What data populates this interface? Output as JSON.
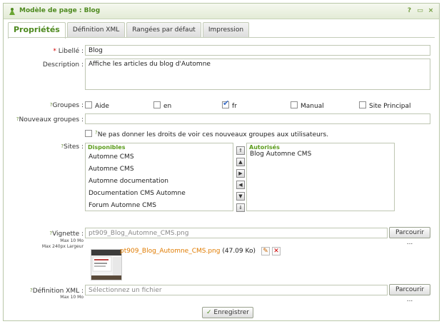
{
  "window": {
    "title": "Modèle de page : Blog",
    "help": "?"
  },
  "tabs": [
    {
      "label": "Propriétés",
      "active": true
    },
    {
      "label": "Définition XML",
      "active": false
    },
    {
      "label": "Rangées par défaut",
      "active": false
    },
    {
      "label": "Impression",
      "active": false
    }
  ],
  "form": {
    "libelle": {
      "label": "Libellé :",
      "required_mark": "*",
      "value": "Blog"
    },
    "description": {
      "label": "Description :",
      "value": "Affiche les articles du blog d'Automne"
    },
    "groupes": {
      "label": "Groupes :",
      "items": [
        {
          "label": "Aide",
          "checked": false
        },
        {
          "label": "en",
          "checked": false
        },
        {
          "label": "fr",
          "checked": true
        },
        {
          "label": "Manual",
          "checked": false
        },
        {
          "label": "Site Principal",
          "checked": false
        }
      ]
    },
    "nouveaux_groupes": {
      "label": "Nouveaux groupes :",
      "value": ""
    },
    "no_rights_label": "Ne pas donner les droits de voir ces nouveaux groupes aux utilisateurs.",
    "sites": {
      "label": "Sites :",
      "available_header": "Disponibles",
      "available": [
        "Automne CMS",
        "Automne CMS",
        "Automne documentation",
        "Documentation CMS Automne",
        "Forum Automne CMS"
      ],
      "authorized_header": "Autorisés",
      "authorized": [
        "Blog Automne CMS"
      ]
    },
    "vignette": {
      "label": "Vignette :",
      "value": "pt909_Blog_Automne_CMS.png",
      "hint1": "Max 10 Mo",
      "hint2": "Max 240px Largeur",
      "file_name": "pt909_Blog_Automne_CMS.png",
      "file_size": "(47.09 Ko)",
      "browse": "Parcourir ..."
    },
    "definition_xml": {
      "label": "Définition XML :",
      "placeholder": "Sélectionnez un fichier",
      "hint": "Max 10 Mo",
      "browse": "Parcourir ..."
    },
    "save": "Enregistrer"
  },
  "colors": {
    "accent": "#4e8a1f",
    "header_green": "#5b9c1c",
    "link_orange": "#e07b00"
  }
}
